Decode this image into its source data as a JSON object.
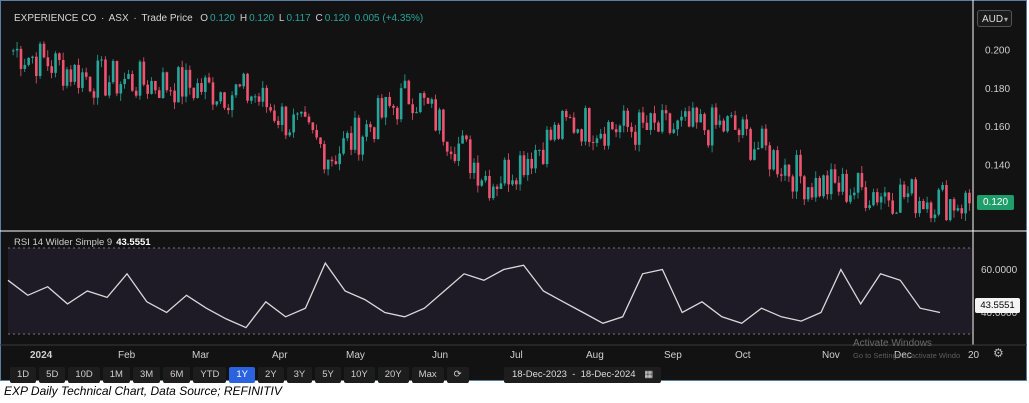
{
  "header": {
    "name": "EXPERIENCE CO",
    "sep1": "·",
    "exchange": "ASX",
    "sep2": "·",
    "series_label": "Trade Price",
    "o_key": "O",
    "o_val": "0.120",
    "h_key": "H",
    "h_val": "0.120",
    "l_key": "L",
    "l_val": "0.117",
    "c_key": "C",
    "c_val": "0.120",
    "change": "0.005 (+4.35%)"
  },
  "currency": "AUD",
  "last_price_tag": "0.120",
  "rsi": {
    "label": "RSI 14 Wilder Simple 9",
    "value": "43.5551",
    "tag": "43.5551"
  },
  "toolbar": {
    "ranges": [
      "1D",
      "5D",
      "10D",
      "1M",
      "3M",
      "6M",
      "YTD",
      "1Y",
      "2Y",
      "3Y",
      "5Y",
      "10Y",
      "20Y",
      "Max"
    ],
    "active": "1Y",
    "date_range": "18-Dec-2023  -  18-Dec-2024"
  },
  "watermark": {
    "line1": "Activate Windows",
    "line2": "Go to Settings to activate Windo"
  },
  "caption": "EXP Daily Technical Chart, Data Source; REFINITIV",
  "colors": {
    "up": "#26a69a",
    "down": "#ef5370",
    "rsi_line": "#d9d9d9",
    "active_btn": "#2a62e0"
  },
  "chart_data": [
    {
      "type": "candlestick",
      "ylim": [
        0.108,
        0.208
      ],
      "y_ticks": [
        "0.200",
        "0.180",
        "0.160",
        "0.140",
        "0.120"
      ],
      "x_ticks": [
        "2024",
        "Feb",
        "Mar",
        "Apr",
        "May",
        "Jun",
        "Jul",
        "Aug",
        "Sep",
        "Oct",
        "Nov",
        "Dec",
        "20"
      ],
      "anchors": [
        {
          "month": "Dec 2023",
          "close": 0.2
        },
        {
          "month": "Jan 2024",
          "close": 0.185
        },
        {
          "month": "Feb",
          "close": 0.182
        },
        {
          "month": "Mar",
          "close": 0.177
        },
        {
          "month": "Apr",
          "close": 0.145
        },
        {
          "month": "May",
          "close": 0.178
        },
        {
          "month": "Jun",
          "close": 0.131
        },
        {
          "month": "Jul",
          "close": 0.162
        },
        {
          "month": "Aug",
          "close": 0.158
        },
        {
          "month": "Sep",
          "close": 0.16
        },
        {
          "month": "Oct",
          "close": 0.13
        },
        {
          "month": "Nov",
          "close": 0.125
        },
        {
          "month": "Dec 2024",
          "close": 0.12
        }
      ]
    },
    {
      "type": "line",
      "name": "RSI 14 Wilder Simple 9",
      "y_ticks": [
        "60.0000",
        "40.0000"
      ],
      "ylim": [
        28,
        72
      ],
      "bands": [
        70,
        30
      ],
      "anchors": [
        55,
        48,
        52,
        44,
        50,
        47,
        58,
        45,
        40,
        48,
        42,
        37,
        33,
        45,
        38,
        42,
        63,
        50,
        46,
        40,
        38,
        42,
        50,
        58,
        55,
        60,
        62,
        50,
        45,
        40,
        35,
        38,
        58,
        60,
        40,
        45,
        38,
        35,
        42,
        38,
        36,
        40,
        60,
        44,
        58,
        55,
        42,
        40
      ]
    }
  ]
}
